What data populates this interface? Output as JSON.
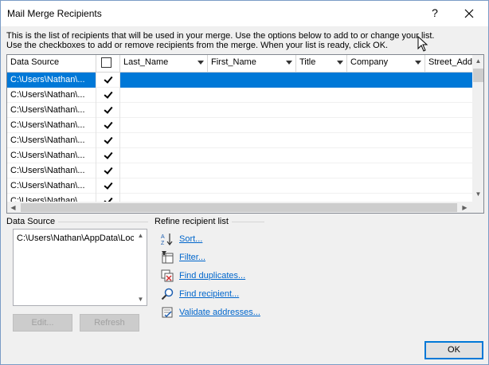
{
  "window": {
    "title": "Mail Merge Recipients",
    "help_label": "?",
    "close_label": "✕"
  },
  "instructions": {
    "line1": "This is the list of recipients that will be used in your merge.  Use the options below to add to or change your list.",
    "line2": "Use the checkboxes to add or remove recipients from the merge.  When your list is ready, click OK."
  },
  "grid": {
    "columns": [
      {
        "label": "Data Source",
        "dropdown": false
      },
      {
        "label": "",
        "type": "checkbox"
      },
      {
        "label": "Last_Name",
        "dropdown": true
      },
      {
        "label": "First_Name",
        "dropdown": true
      },
      {
        "label": "Title",
        "dropdown": true
      },
      {
        "label": "Company",
        "dropdown": true
      },
      {
        "label": "Street_Addr",
        "dropdown": false
      }
    ],
    "rows": [
      {
        "source": "C:\\Users\\Nathan\\...",
        "checked": true,
        "selected": true
      },
      {
        "source": "C:\\Users\\Nathan\\...",
        "checked": true,
        "selected": false
      },
      {
        "source": "C:\\Users\\Nathan\\...",
        "checked": true,
        "selected": false
      },
      {
        "source": "C:\\Users\\Nathan\\...",
        "checked": true,
        "selected": false
      },
      {
        "source": "C:\\Users\\Nathan\\...",
        "checked": true,
        "selected": false
      },
      {
        "source": "C:\\Users\\Nathan\\...",
        "checked": true,
        "selected": false
      },
      {
        "source": "C:\\Users\\Nathan\\...",
        "checked": true,
        "selected": false
      },
      {
        "source": "C:\\Users\\Nathan\\...",
        "checked": true,
        "selected": false
      },
      {
        "source": "C:\\Users\\Nathan\\...",
        "checked": true,
        "selected": false
      }
    ]
  },
  "data_source": {
    "label": "Data Source",
    "item": "C:\\Users\\Nathan\\AppData\\Local",
    "edit_label": "Edit...",
    "refresh_label": "Refresh"
  },
  "refine": {
    "label": "Refine recipient list",
    "sort": "Sort...",
    "filter": "Filter...",
    "find_duplicates": "Find duplicates...",
    "find_recipient": "Find recipient...",
    "validate": "Validate addresses..."
  },
  "ok_label": "OK",
  "colors": {
    "selection": "#0078d7",
    "link": "#0066cc",
    "dialog_bg": "#f0f0f0"
  }
}
